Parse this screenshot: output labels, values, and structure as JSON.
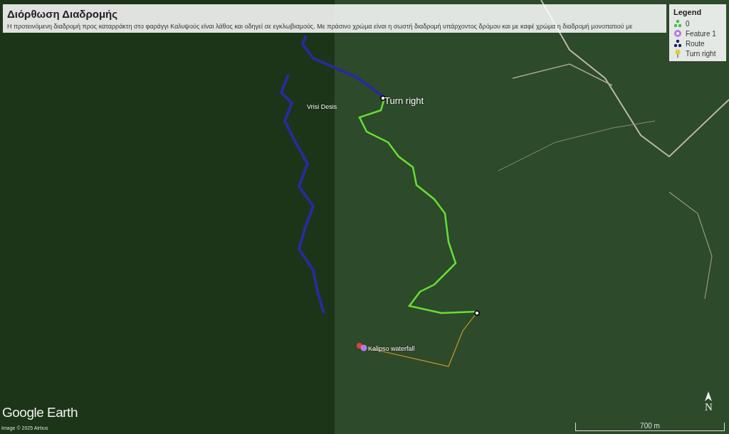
{
  "header": {
    "title": "Διόρθωση Διαδρομής",
    "description": "Η προτεινόμενη διαδρομή προς καταρράκτη στο φαράγγι Καλυψούς είναι λάθος και οδηγεί σε εγκλωβισμούς. Με πράσινο χρώμα είναι η σωστή διαδρομή υπάρχοντος δρόμου και με καφέ χρώμα η διαδρομή μονοπατιού με"
  },
  "legend": {
    "title": "Legend",
    "items": [
      {
        "label": "0",
        "kind": "cluster",
        "color": "#3cc23c"
      },
      {
        "label": "Feature 1",
        "kind": "circle",
        "color": "#b57be8"
      },
      {
        "label": "Route",
        "kind": "cluster",
        "color": "#1c1c6e"
      },
      {
        "label": "Turn right",
        "kind": "pin",
        "color": "#d8d040"
      }
    ]
  },
  "map_labels": [
    {
      "text": "Vrisi Desis",
      "kind": "place"
    },
    {
      "text": "Turn right",
      "kind": "point"
    },
    {
      "text": "Kalipso waterfall",
      "kind": "waterfall"
    }
  ],
  "branding": {
    "logo": "Google Earth",
    "attribution": "Image © 2025 Airbus"
  },
  "scale_bar": {
    "label": "700 m"
  },
  "compass": {
    "label": "N"
  }
}
